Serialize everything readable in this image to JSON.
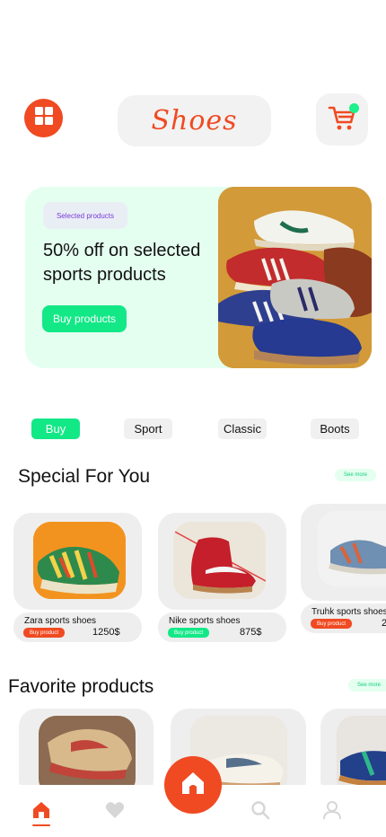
{
  "header": {
    "logo_text": "Shoes",
    "menu_icon": "grid-icon",
    "cart_icon": "cart-icon",
    "accent": "#f04a22",
    "badge_color": "#1ef08c"
  },
  "banner": {
    "chip_label": "Selected products",
    "title": "50% off on selected sports products",
    "button_label": "Buy products",
    "background": "#e4fff0"
  },
  "categories": [
    {
      "label": "Buy",
      "active": true
    },
    {
      "label": "Sport",
      "active": false
    },
    {
      "label": "Classic",
      "active": false
    },
    {
      "label": "Boots",
      "active": false
    }
  ],
  "special": {
    "title": "Special For You",
    "see_more": "See more",
    "products": [
      {
        "name": "Zara sports shoes",
        "buy_label": "Buy product",
        "price": "1250$",
        "buy_color": "#f04a22"
      },
      {
        "name": "Nike sports shoes",
        "buy_label": "Buy product",
        "price": "875$",
        "buy_color": "#13e887"
      },
      {
        "name": "Truhk sports shoes",
        "buy_label": "Buy product",
        "price": "2",
        "buy_color": "#f04a22"
      }
    ]
  },
  "favorites": {
    "title": "Favorite products",
    "see_more": "See more"
  },
  "bottom_nav": {
    "items": [
      "home-icon",
      "heart-icon",
      "search-icon",
      "user-icon"
    ],
    "center_button": "home-icon",
    "active": "home-icon"
  }
}
